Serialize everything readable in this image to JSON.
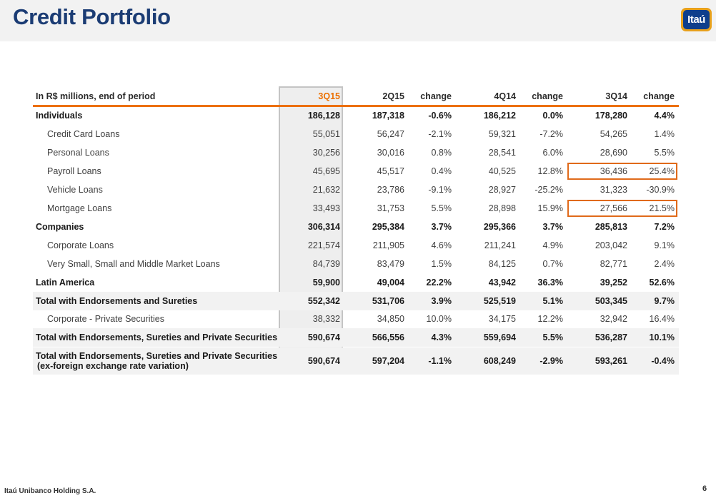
{
  "title": "Credit Portfolio",
  "logo": {
    "text": "Itaú",
    "colors": {
      "frame": "#e8a11c",
      "fill": "#0e3e8c"
    }
  },
  "colors": {
    "title": "#1b3c74",
    "accent": "#ec7000",
    "highlight_box": "#e06a1a",
    "band": "#eeeeee"
  },
  "table": {
    "header": {
      "label": "In R$ millions, end of period",
      "cols": [
        "3Q15",
        "2Q15",
        "change",
        "4Q14",
        "change",
        "3Q14",
        "change"
      ]
    },
    "rows": [
      {
        "label": "Individuals",
        "values": [
          "186,128",
          "187,318",
          "-0.6%",
          "186,212",
          "0.0%",
          "178,280",
          "4.4%"
        ]
      },
      {
        "label": "Credit Card Loans",
        "values": [
          "55,051",
          "56,247",
          "-2.1%",
          "59,321",
          "-7.2%",
          "54,265",
          "1.4%"
        ]
      },
      {
        "label": "Personal Loans",
        "values": [
          "30,256",
          "30,016",
          "0.8%",
          "28,541",
          "6.0%",
          "28,690",
          "5.5%"
        ]
      },
      {
        "label": "Payroll Loans",
        "values": [
          "45,695",
          "45,517",
          "0.4%",
          "40,525",
          "12.8%",
          "36,436",
          "25.4%"
        ]
      },
      {
        "label": "Vehicle Loans",
        "values": [
          "21,632",
          "23,786",
          "-9.1%",
          "28,927",
          "-25.2%",
          "31,323",
          "-30.9%"
        ]
      },
      {
        "label": "Mortgage Loans",
        "values": [
          "33,493",
          "31,753",
          "5.5%",
          "28,898",
          "15.9%",
          "27,566",
          "21.5%"
        ]
      },
      {
        "label": "Companies",
        "values": [
          "306,314",
          "295,384",
          "3.7%",
          "295,366",
          "3.7%",
          "285,813",
          "7.2%"
        ]
      },
      {
        "label": "Corporate Loans",
        "values": [
          "221,574",
          "211,905",
          "4.6%",
          "211,241",
          "4.9%",
          "203,042",
          "9.1%"
        ]
      },
      {
        "label": "Very Small, Small and Middle Market Loans",
        "values": [
          "84,739",
          "83,479",
          "1.5%",
          "84,125",
          "0.7%",
          "82,771",
          "2.4%"
        ]
      },
      {
        "label": "Latin America",
        "values": [
          "59,900",
          "49,004",
          "22.2%",
          "43,942",
          "36.3%",
          "39,252",
          "52.6%"
        ]
      },
      {
        "label": "Total with Endorsements and Sureties",
        "values": [
          "552,342",
          "531,706",
          "3.9%",
          "525,519",
          "5.1%",
          "503,345",
          "9.7%"
        ]
      },
      {
        "label": "Corporate - Private Securities",
        "values": [
          "38,332",
          "34,850",
          "10.0%",
          "34,175",
          "12.2%",
          "32,942",
          "16.4%"
        ]
      },
      {
        "label": "Total with Endorsements, Sureties and Private Securities",
        "values": [
          "590,674",
          "566,556",
          "4.3%",
          "559,694",
          "5.5%",
          "536,287",
          "10.1%"
        ]
      },
      {
        "label": "Total with Endorsements, Sureties and Private Securities",
        "label2": "(ex-foreign exchange rate variation)",
        "values": [
          "590,674",
          "597,204",
          "-1.1%",
          "608,249",
          "-2.9%",
          "593,261",
          "-0.4%"
        ]
      }
    ]
  },
  "footer": {
    "company": "Itaú Unibanco Holding S.A.",
    "page": "6"
  }
}
